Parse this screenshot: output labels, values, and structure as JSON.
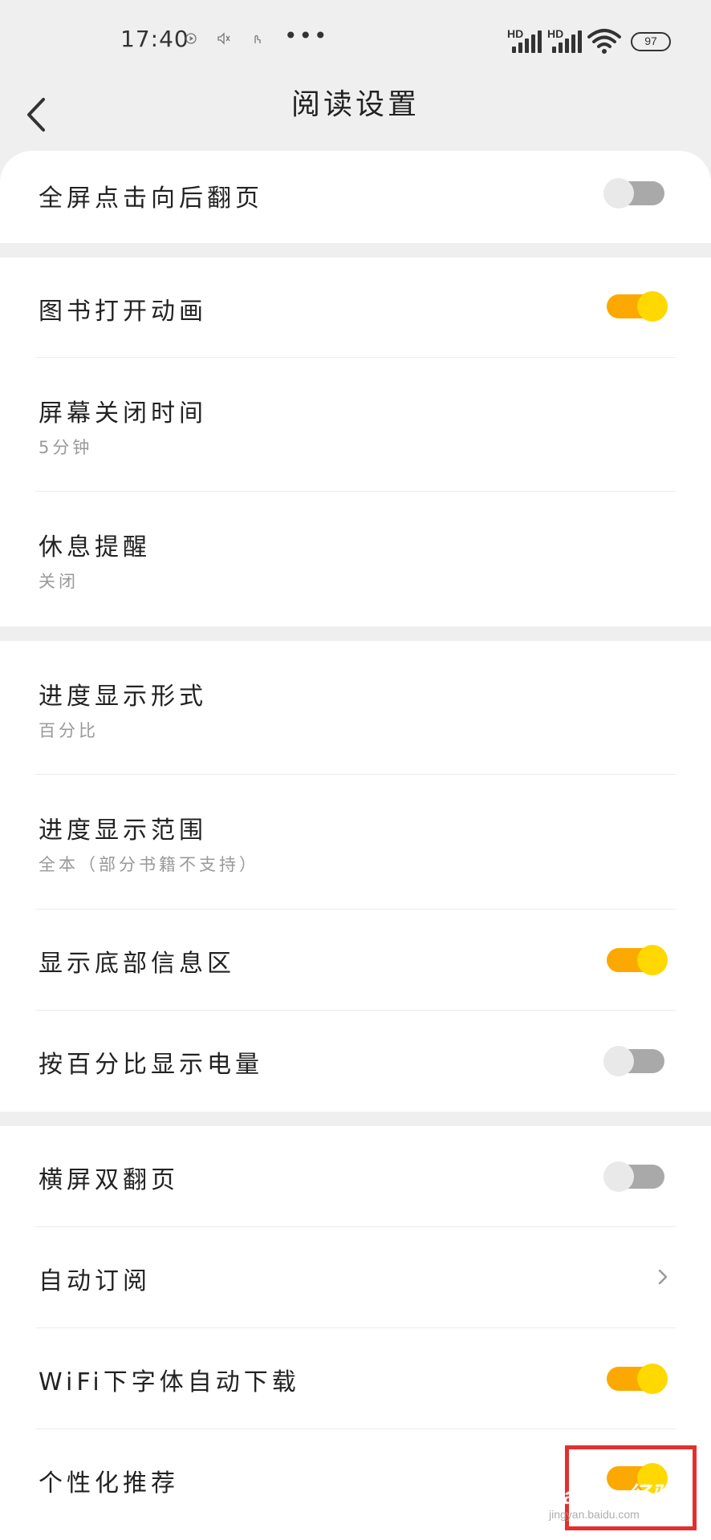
{
  "status_bar": {
    "time": "17:40",
    "icons": [
      "play-icon",
      "mute-icon",
      "touch-icon"
    ],
    "more_dots": "•••",
    "signal_1_label": "HD",
    "signal_2_label": "HD",
    "battery": "97"
  },
  "header": {
    "title": "阅读设置"
  },
  "colors": {
    "accent_track": "#fba900",
    "accent_knob": "#ffd800",
    "off_track": "#a9a9a9",
    "background": "#efefef"
  },
  "settings": {
    "fullscreen_tap": {
      "title": "全屏点击向后翻页",
      "enabled": false
    },
    "book_open_animation": {
      "title": "图书打开动画",
      "enabled": true
    },
    "screen_off_time": {
      "title": "屏幕关闭时间",
      "value": "5分钟"
    },
    "rest_reminder": {
      "title": "休息提醒",
      "value": "关闭"
    },
    "progress_format": {
      "title": "进度显示形式",
      "value": "百分比"
    },
    "progress_range": {
      "title": "进度显示范围",
      "value": "全本（部分书籍不支持）"
    },
    "bottom_info": {
      "title": "显示底部信息区",
      "enabled": true
    },
    "battery_percent": {
      "title": "按百分比显示电量",
      "enabled": false
    },
    "landscape_double": {
      "title": "横屏双翻页",
      "enabled": false
    },
    "auto_subscribe": {
      "title": "自动订阅"
    },
    "wifi_font_download": {
      "title": "WiFi下字体自动下载",
      "enabled": true
    },
    "personalized": {
      "title": "个性化推荐",
      "enabled": true
    }
  },
  "watermark": {
    "brand": "Bai du 经验",
    "url": "jingyan.baidu.com"
  }
}
